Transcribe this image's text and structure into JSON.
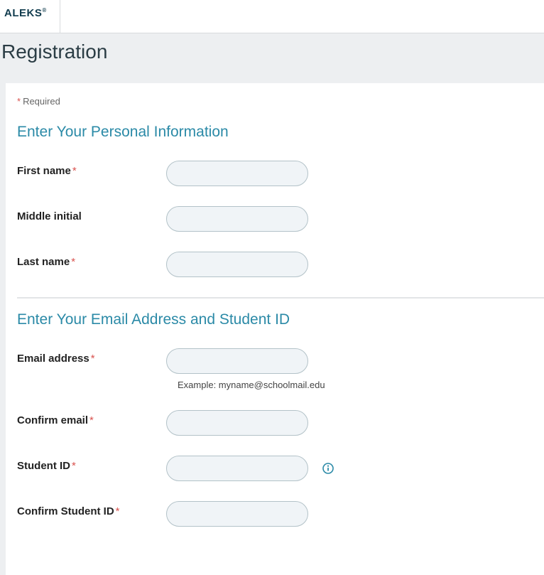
{
  "brand": "ALEKS",
  "brand_suffix": "®",
  "page_title": "Registration",
  "required_label": "Required",
  "section1": {
    "title": "Enter Your Personal Information",
    "first_name": {
      "label": "First name",
      "value": ""
    },
    "middle_initial": {
      "label": "Middle initial",
      "value": ""
    },
    "last_name": {
      "label": "Last name",
      "value": ""
    }
  },
  "section2": {
    "title": "Enter Your Email Address and Student ID",
    "email": {
      "label": "Email address",
      "value": "",
      "hint": "Example: myname@schoolmail.edu"
    },
    "confirm_email": {
      "label": "Confirm email",
      "value": ""
    },
    "student_id": {
      "label": "Student ID",
      "value": ""
    },
    "confirm_student_id": {
      "label": "Confirm Student ID",
      "value": ""
    }
  },
  "icons": {
    "info": "info-icon"
  },
  "colors": {
    "accent": "#2b8aa7",
    "required": "#d9534f"
  }
}
